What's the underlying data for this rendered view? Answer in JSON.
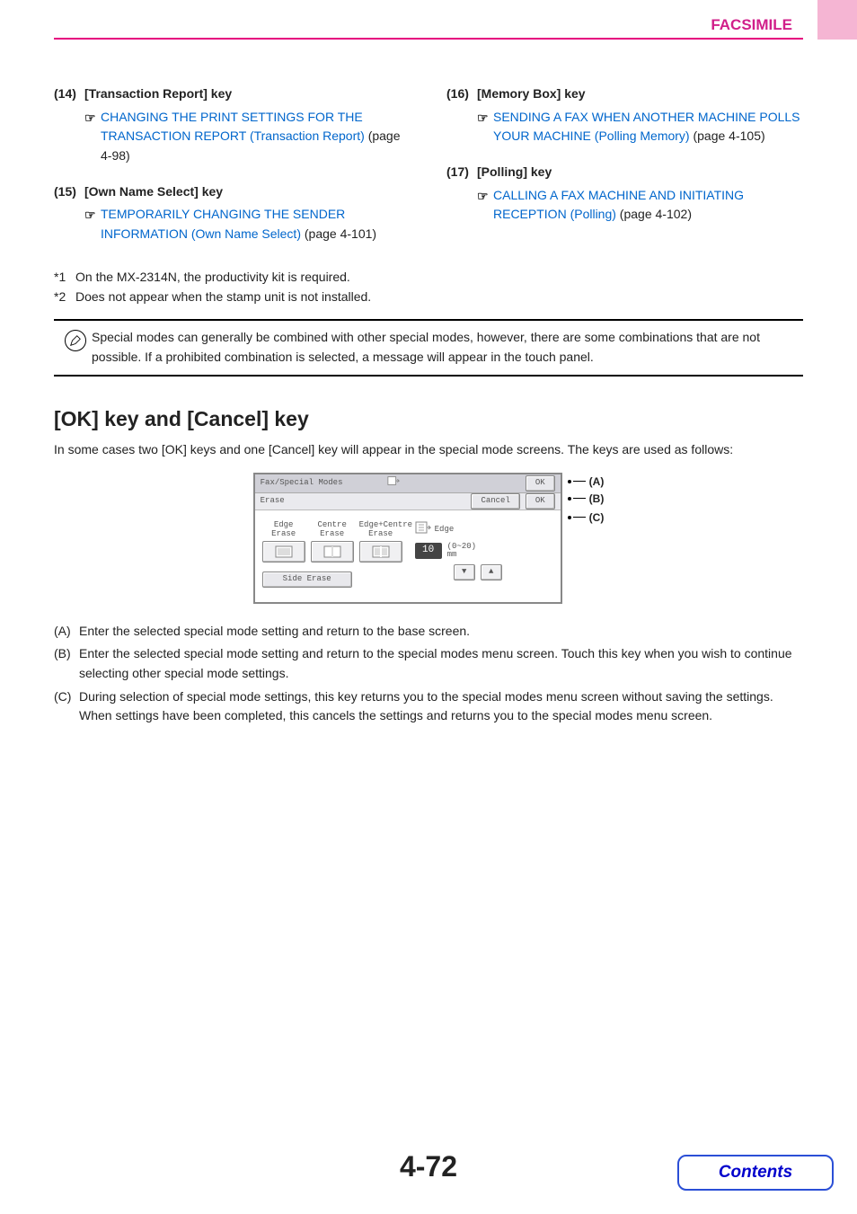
{
  "header": {
    "title": "FACSIMILE"
  },
  "left_items": [
    {
      "num": "(14)",
      "title": "[Transaction Report] key",
      "link": "CHANGING THE PRINT SETTINGS FOR THE TRANSACTION REPORT (Transaction Report)",
      "after": " (page 4-98)"
    },
    {
      "num": "(15)",
      "title": "[Own Name Select] key",
      "link": "TEMPORARILY CHANGING THE SENDER INFORMATION (Own Name Select)",
      "after": " (page 4-101)"
    }
  ],
  "right_items": [
    {
      "num": "(16)",
      "title": "[Memory Box] key",
      "link": "SENDING A FAX WHEN ANOTHER MACHINE POLLS YOUR MACHINE (Polling Memory)",
      "after": " (page 4-105)"
    },
    {
      "num": "(17)",
      "title": "[Polling] key",
      "link": "CALLING A FAX MACHINE AND INITIATING RECEPTION (Polling)",
      "after": " (page 4-102)"
    }
  ],
  "footnotes": [
    {
      "mark": "*1",
      "text": "On the MX-2314N, the productivity kit is required."
    },
    {
      "mark": "*2",
      "text": "Does not appear when the stamp unit is not installed."
    }
  ],
  "note": "Special modes can generally be combined with other special modes, however, there are some combinations that are not possible. If a prohibited combination is selected, a message will appear in the touch panel.",
  "section_heading": "[OK] key and [Cancel] key",
  "section_intro": "In some cases two [OK] keys and one [Cancel] key will appear in the special mode screens. The keys are used as follows:",
  "ui": {
    "row1_title": "Fax/Special Modes",
    "ok": "OK",
    "row2_title": "Erase",
    "cancel": "Cancel",
    "tiles": [
      {
        "l1": "Edge",
        "l2": "Erase"
      },
      {
        "l1": "Centre",
        "l2": "Erase"
      },
      {
        "l1": "Edge+Centre",
        "l2": "Erase"
      }
    ],
    "side_erase": "Side Erase",
    "edge_label": "Edge",
    "value": "10",
    "range": "(0~20)",
    "unit": "mm",
    "labels": {
      "a": "(A)",
      "b": "(B)",
      "c": "(C)"
    }
  },
  "definitions": [
    {
      "mark": "(A)",
      "text": "Enter the selected special mode setting and return to the base screen."
    },
    {
      "mark": "(B)",
      "text": "Enter the selected special mode setting and return to the special modes menu screen. Touch this key when you wish to continue selecting other special mode settings."
    },
    {
      "mark": "(C)",
      "text": "During selection of special mode settings, this key returns you to the special modes menu screen without saving the settings. When settings have been completed, this cancels the settings and returns you to the special modes menu screen."
    }
  ],
  "page_number": "4-72",
  "contents_button": "Contents"
}
